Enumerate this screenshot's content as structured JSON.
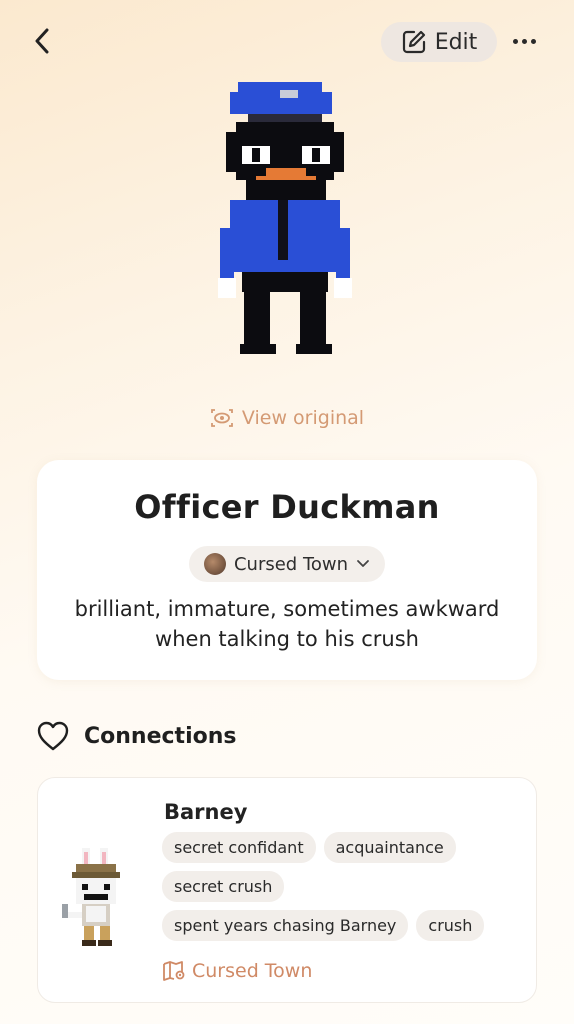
{
  "topbar": {
    "edit_label": "Edit"
  },
  "character": {
    "view_original": "View original",
    "name": "Officer Duckman",
    "world": "Cursed Town",
    "description": "brilliant, immature, sometimes awkward when talking to his crush"
  },
  "connections": {
    "title": "Connections",
    "items": [
      {
        "name": "Barney",
        "tags": [
          "secret confidant",
          "acquaintance",
          "secret crush",
          "spent years chasing Barney",
          "crush"
        ],
        "world": "Cursed Town"
      }
    ]
  },
  "colors": {
    "accent": "#d49a74",
    "world_link": "#d08a66",
    "pill_bg": "#f2eeea",
    "police_blue": "#2a4fd6"
  },
  "icons": {
    "back": "chevron-left-icon",
    "edit": "edit-icon",
    "more": "more-horizontal-icon",
    "view": "eye-scan-icon",
    "world_pill": "world-thumbnail",
    "dropdown": "chevron-down-icon",
    "connections": "heart-outline-icon",
    "world_link": "map-pin-icon"
  }
}
